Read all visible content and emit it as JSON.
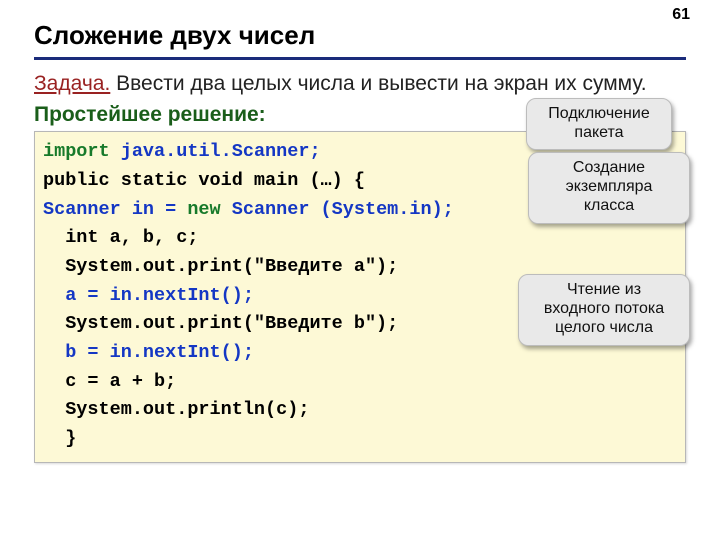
{
  "page_number": "61",
  "title": "Сложение двух чисел",
  "task_label": "Задача.",
  "task_text": " Ввести два целых числа и вывести на экран их сумму.",
  "solution_label": "Простейшее решение:",
  "code": {
    "l1a": "import",
    "l1b": " java.util.Scanner;",
    "l2": "public static void main (…) {",
    "l3a": "Scanner in = ",
    "l3b": "new",
    "l3c": " Scanner (System.in);",
    "l4": "  int a, b, c;",
    "l5": "  System.out.print(\"Введите a\");",
    "l6": "  a = in.nextInt();",
    "l7": "  System.out.print(\"Введите b\");",
    "l8": "  b = in.nextInt();",
    "l9": "  c = a + b;",
    "l10": "  System.out.println(c);",
    "l11": "  }"
  },
  "callouts": {
    "c1_l1": "Подключение",
    "c1_l2": "пакета",
    "c2_l1": "Создание",
    "c2_l2": "экземпляра",
    "c2_l3": "класса",
    "c3_l1": "Чтение из",
    "c3_l2": "входного потока",
    "c3_l3": "целого числа"
  }
}
